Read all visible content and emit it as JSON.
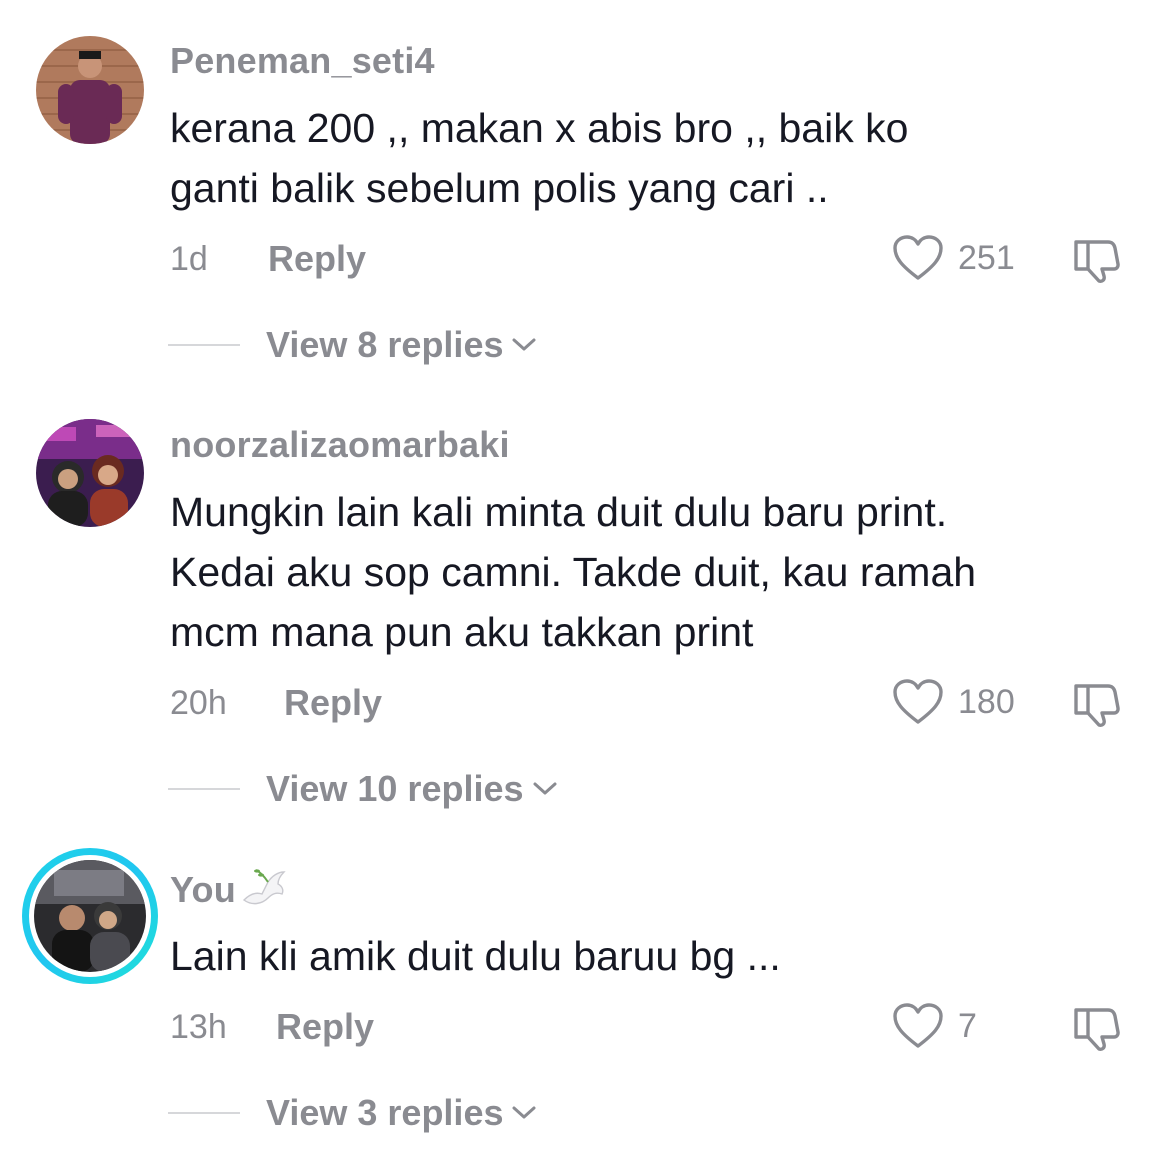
{
  "comments": [
    {
      "username": "Peneman_seti4",
      "text_lines": [
        "kerana 200 ,, makan x abis bro ,, baik ko",
        "ganti balik sebelum polis yang cari .."
      ],
      "time": "1d",
      "reply_label": "Reply",
      "likes": "251",
      "view_replies": "View 8 replies"
    },
    {
      "username": "noorzalizaomarbaki",
      "text_lines": [
        "Mungkin lain kali minta duit dulu baru print.",
        "Kedai aku sop camni. Takde duit, kau ramah",
        "mcm mana pun aku takkan print"
      ],
      "time": "20h",
      "reply_label": "Reply",
      "likes": "180",
      "view_replies": "View 10 replies"
    },
    {
      "username": "You",
      "username_emoji": "dove-icon",
      "text_lines": [
        "Lain kli amik duit dulu baruu bg ..."
      ],
      "time": "13h",
      "reply_label": "Reply",
      "likes": "7",
      "view_replies": "View 3 replies"
    }
  ],
  "icons": {
    "like": "heart-outline-icon",
    "dislike": "thumbs-down-outline-icon",
    "expand": "chevron-down-icon"
  },
  "colors": {
    "text": "#161823",
    "muted": "#8a8b91",
    "ring": "#20c6f0"
  }
}
